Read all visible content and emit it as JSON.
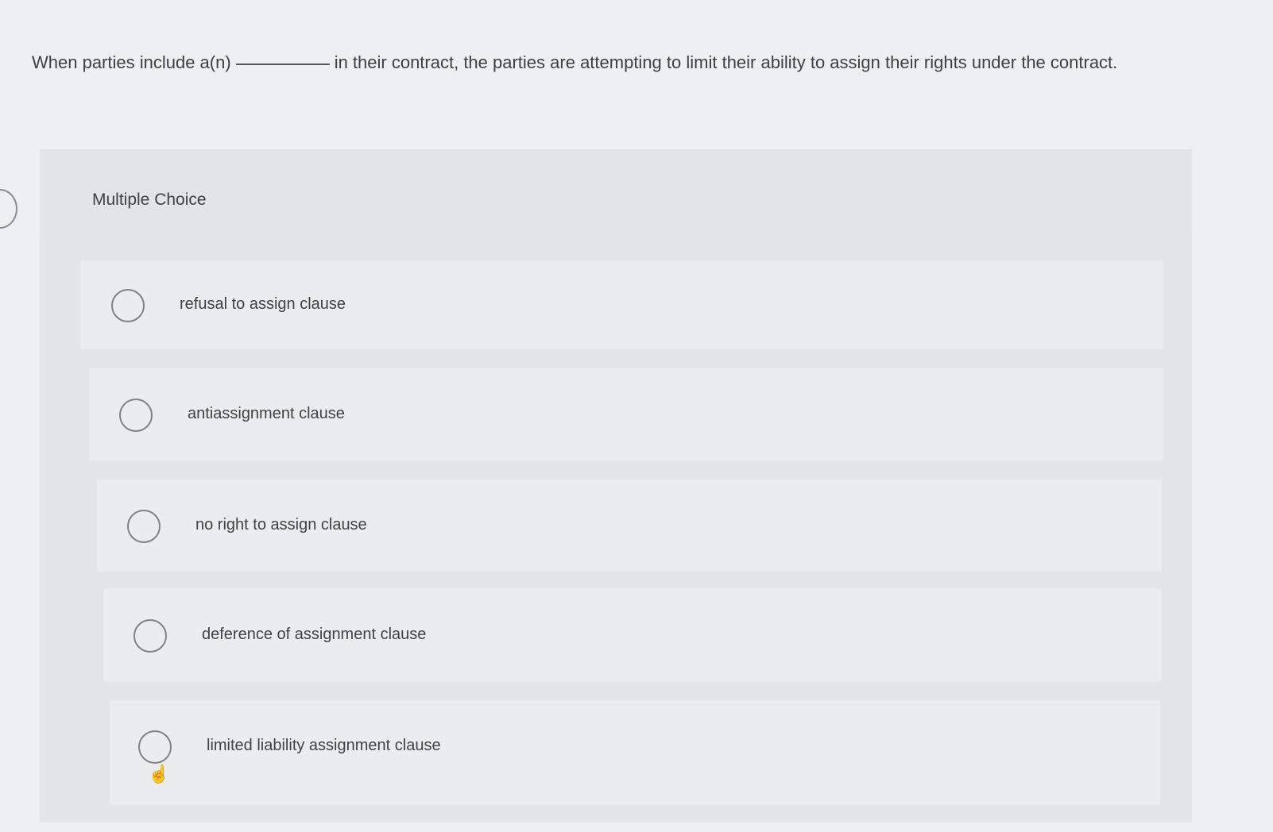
{
  "question": {
    "text_before": "When parties include a(n)",
    "text_after": "in their contract, the parties are attempting to limit their ability to assign their rights under the contract."
  },
  "mc": {
    "label": "Multiple Choice",
    "options": [
      {
        "label": "refusal to assign clause"
      },
      {
        "label": "antiassignment clause"
      },
      {
        "label": "no right to assign clause"
      },
      {
        "label": "deference of assignment clause"
      },
      {
        "label": "limited liability assignment clause"
      }
    ]
  },
  "icons": {
    "radio": "radio-unselected-icon",
    "cursor": "hand-pointer-icon"
  }
}
